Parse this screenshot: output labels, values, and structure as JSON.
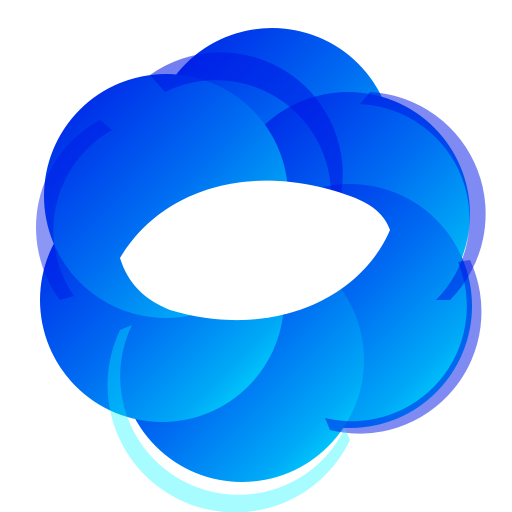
{
  "graphic": {
    "icon": "blue-swirl-ring-logo",
    "petal_count": 6,
    "colors": {
      "background": "#ffffff",
      "deep_blue": "#0016E6",
      "mid_blue": "#006DF2",
      "light_blue": "#00A9F7",
      "cyan": "#00F6FF"
    }
  }
}
